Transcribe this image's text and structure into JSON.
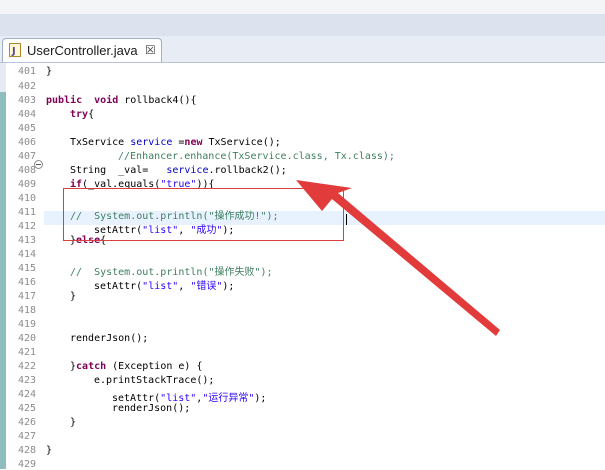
{
  "tab": {
    "title": "UserController.java",
    "close": "☒"
  },
  "colors": {
    "keyword": "#7f0055",
    "string": "#2a00ff",
    "comment": "#3f7f5f",
    "field": "#0000c0",
    "annotation": "#e23b3b"
  },
  "lines": [
    {
      "n": "401",
      "t": "}"
    },
    {
      "n": "402",
      "t": ""
    },
    {
      "n": "403",
      "kw": "public  void",
      "t": " rollback4(){"
    },
    {
      "n": "404",
      "kw": "try",
      "t": "{"
    },
    {
      "n": "405",
      "t": ""
    },
    {
      "n": "406",
      "t1": "TxService ",
      "fld": "service",
      "t2": " =",
      "kw": "new",
      "t3": " TxService();"
    },
    {
      "n": "407",
      "cmt": "//Enhancer.enhance(TxService.class, Tx.class);"
    },
    {
      "n": "408",
      "t1": "String  _val=   ",
      "fld": "service",
      "t2": ".rollback2();"
    },
    {
      "n": "409",
      "kw": "if",
      "t1": "(_val.equals(",
      "str": "\"true\"",
      "t2": ")){"
    },
    {
      "n": "410",
      "t": ""
    },
    {
      "n": "411",
      "cmt": "//  System.out.println(\"操作成功!\");"
    },
    {
      "n": "412",
      "t1": "setAttr(",
      "str1": "\"list\"",
      "t2": ", ",
      "str2": "\"成功\"",
      "t3": ");"
    },
    {
      "n": "413",
      "t1": "}",
      "kw": "else",
      "t2": "{"
    },
    {
      "n": "414",
      "t": ""
    },
    {
      "n": "415",
      "cmt": "//  System.out.println(\"操作失败\");"
    },
    {
      "n": "416",
      "t1": "setAttr(",
      "str1": "\"list\"",
      "t2": ", ",
      "str2": "\"错误\"",
      "t3": ");"
    },
    {
      "n": "417",
      "t": "}"
    },
    {
      "n": "418",
      "t": ""
    },
    {
      "n": "419",
      "t": ""
    },
    {
      "n": "420",
      "t": "renderJson();"
    },
    {
      "n": "421",
      "t": ""
    },
    {
      "n": "422",
      "t1": "}",
      "kw": "catch",
      "t2": " (Exception e) {"
    },
    {
      "n": "423",
      "t": "e.printStackTrace();"
    },
    {
      "n": "424",
      "t1": "setAttr(",
      "str1": "\"list\"",
      "t2": ",",
      "str2": "\"运行异常\"",
      "t3": ");"
    },
    {
      "n": "425",
      "t": "renderJson();"
    },
    {
      "n": "426",
      "t": "}"
    },
    {
      "n": "427",
      "t": ""
    },
    {
      "n": "428",
      "t": "}"
    },
    {
      "n": "429",
      "t": ""
    }
  ]
}
